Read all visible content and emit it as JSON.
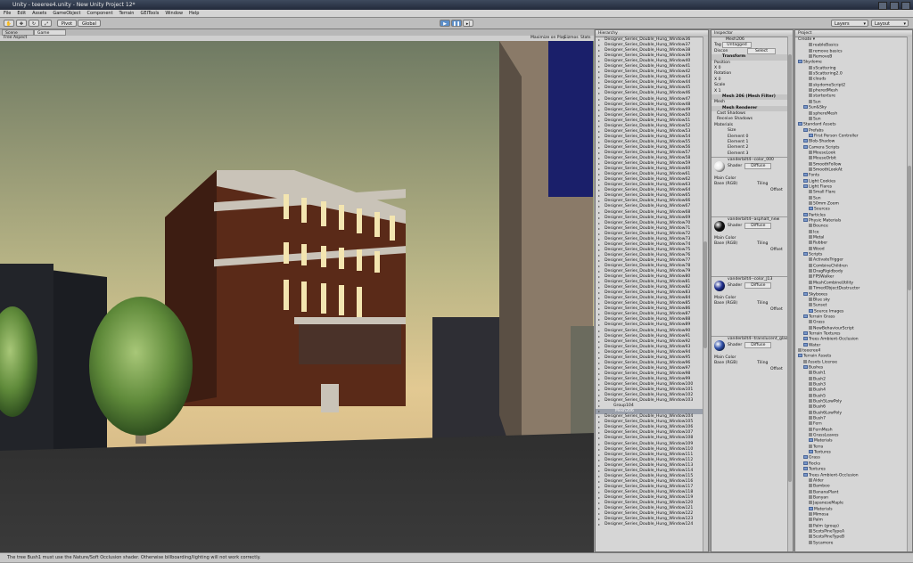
{
  "window": {
    "title": "Unity - teeeree4.unity - New Unity Project 12*"
  },
  "menu": [
    "File",
    "Edit",
    "Assets",
    "GameObject",
    "Component",
    "Terrain",
    "GEITools",
    "Window",
    "Help"
  ],
  "toolbar": {
    "pivot": "Pivot",
    "global": "Global",
    "layers": "Layers",
    "layout": "Layout"
  },
  "game": {
    "tabs": [
      "Scene",
      "Game"
    ],
    "aspect": "Free Aspect",
    "buttons": [
      "Maximize on Play",
      "Gizmos",
      "Stats"
    ]
  },
  "hierarchy": {
    "title": "Hierarchy",
    "group_label": "Group104",
    "selected_label": "Mesh206",
    "rows_a": [
      "Designer_Series_Double_Hung_Window36",
      "Designer_Series_Double_Hung_Window37",
      "Designer_Series_Double_Hung_Window38",
      "Designer_Series_Double_Hung_Window39",
      "Designer_Series_Double_Hung_Window40",
      "Designer_Series_Double_Hung_Window41",
      "Designer_Series_Double_Hung_Window42",
      "Designer_Series_Double_Hung_Window43",
      "Designer_Series_Double_Hung_Window44",
      "Designer_Series_Double_Hung_Window45",
      "Designer_Series_Double_Hung_Window46",
      "Designer_Series_Double_Hung_Window47",
      "Designer_Series_Double_Hung_Window48",
      "Designer_Series_Double_Hung_Window49",
      "Designer_Series_Double_Hung_Window50",
      "Designer_Series_Double_Hung_Window51",
      "Designer_Series_Double_Hung_Window52",
      "Designer_Series_Double_Hung_Window53",
      "Designer_Series_Double_Hung_Window54",
      "Designer_Series_Double_Hung_Window55",
      "Designer_Series_Double_Hung_Window56",
      "Designer_Series_Double_Hung_Window57",
      "Designer_Series_Double_Hung_Window58",
      "Designer_Series_Double_Hung_Window59",
      "Designer_Series_Double_Hung_Window60",
      "Designer_Series_Double_Hung_Window61",
      "Designer_Series_Double_Hung_Window62",
      "Designer_Series_Double_Hung_Window63",
      "Designer_Series_Double_Hung_Window64",
      "Designer_Series_Double_Hung_Window65",
      "Designer_Series_Double_Hung_Window66",
      "Designer_Series_Double_Hung_Window67",
      "Designer_Series_Double_Hung_Window68",
      "Designer_Series_Double_Hung_Window69",
      "Designer_Series_Double_Hung_Window70",
      "Designer_Series_Double_Hung_Window71",
      "Designer_Series_Double_Hung_Window72",
      "Designer_Series_Double_Hung_Window73",
      "Designer_Series_Double_Hung_Window74",
      "Designer_Series_Double_Hung_Window75",
      "Designer_Series_Double_Hung_Window76",
      "Designer_Series_Double_Hung_Window77",
      "Designer_Series_Double_Hung_Window78",
      "Designer_Series_Double_Hung_Window79",
      "Designer_Series_Double_Hung_Window80",
      "Designer_Series_Double_Hung_Window81",
      "Designer_Series_Double_Hung_Window82",
      "Designer_Series_Double_Hung_Window83",
      "Designer_Series_Double_Hung_Window84",
      "Designer_Series_Double_Hung_Window85",
      "Designer_Series_Double_Hung_Window86",
      "Designer_Series_Double_Hung_Window87",
      "Designer_Series_Double_Hung_Window88",
      "Designer_Series_Double_Hung_Window89",
      "Designer_Series_Double_Hung_Window90",
      "Designer_Series_Double_Hung_Window91",
      "Designer_Series_Double_Hung_Window92",
      "Designer_Series_Double_Hung_Window93",
      "Designer_Series_Double_Hung_Window94",
      "Designer_Series_Double_Hung_Window95",
      "Designer_Series_Double_Hung_Window96",
      "Designer_Series_Double_Hung_Window97",
      "Designer_Series_Double_Hung_Window98",
      "Designer_Series_Double_Hung_Window99",
      "Designer_Series_Double_Hung_Window100",
      "Designer_Series_Double_Hung_Window101",
      "Designer_Series_Double_Hung_Window102",
      "Designer_Series_Double_Hung_Window103"
    ],
    "rows_b": [
      "Designer_Series_Double_Hung_Window104",
      "Designer_Series_Double_Hung_Window105",
      "Designer_Series_Double_Hung_Window106",
      "Designer_Series_Double_Hung_Window107",
      "Designer_Series_Double_Hung_Window108",
      "Designer_Series_Double_Hung_Window109",
      "Designer_Series_Double_Hung_Window110",
      "Designer_Series_Double_Hung_Window111",
      "Designer_Series_Double_Hung_Window112",
      "Designer_Series_Double_Hung_Window113",
      "Designer_Series_Double_Hung_Window114",
      "Designer_Series_Double_Hung_Window115",
      "Designer_Series_Double_Hung_Window116",
      "Designer_Series_Double_Hung_Window117",
      "Designer_Series_Double_Hung_Window118",
      "Designer_Series_Double_Hung_Window119",
      "Designer_Series_Double_Hung_Window120",
      "Designer_Series_Double_Hung_Window121",
      "Designer_Series_Double_Hung_Window122",
      "Designer_Series_Double_Hung_Window123",
      "Designer_Series_Double_Hung_Window124"
    ]
  },
  "inspector": {
    "title": "Inspector",
    "object_name": "Mesh206",
    "tag_label": "Tag",
    "tag_value": "Untagged",
    "discon_label": "Discon",
    "select_btn": "Select",
    "transform": "Transform",
    "position": "Position",
    "rotation": "Rotation",
    "scale": "Scale",
    "xyz": [
      "X",
      "Y",
      "Z"
    ],
    "position_values": [
      "0",
      "0",
      "0"
    ],
    "rotation_values": [
      "0",
      "0",
      "0"
    ],
    "scale_values": [
      "1",
      "1",
      "1"
    ],
    "mesh_filter": "Mesh 206 (Mesh Filter)",
    "mesh_label": "Mesh",
    "mesh_renderer": "Mesh Renderer",
    "cast_shadows": "Cast Shadows",
    "receive_shadows": "Receive Shadows",
    "materials": "Materials",
    "size": "Size",
    "elements": [
      "Element 0",
      "Element 1",
      "Element 2",
      "Element 3"
    ],
    "shader_label": "Shader",
    "shader_value": "Diffuse",
    "main_color": "Main Color",
    "base_rgb": "Base (RGB)",
    "tiling": "Tiling",
    "offset": "Offset",
    "mats": [
      {
        "name": "vanderbilt4--color_000",
        "color": "#e8e8e8"
      },
      {
        "name": "vanderbilt4--asphalt_new",
        "color": "#111111"
      },
      {
        "name": "vanderbilt4--color_J13",
        "color": "#1f2f8f"
      },
      {
        "name": "vanderbilt4--translucent_glass_1",
        "color": "#2f4fa8"
      }
    ]
  },
  "project": {
    "title": "Project",
    "create": "Create",
    "items": [
      {
        "t": "reableBasics",
        "i": 2,
        "k": "f"
      },
      {
        "t": "remove basics",
        "i": 2,
        "k": "f"
      },
      {
        "t": "RemoveB",
        "i": 2,
        "k": "f"
      },
      {
        "t": "Skydome",
        "i": 0,
        "k": "d"
      },
      {
        "t": "sScattering",
        "i": 2,
        "k": "f"
      },
      {
        "t": "sScattering2.0",
        "i": 2,
        "k": "f"
      },
      {
        "t": "clouds",
        "i": 2,
        "k": "f"
      },
      {
        "t": "skydomeScript2",
        "i": 2,
        "k": "f"
      },
      {
        "t": "pheredMesh",
        "i": 2,
        "k": "f"
      },
      {
        "t": "startexture",
        "i": 2,
        "k": "f"
      },
      {
        "t": "Sun",
        "i": 2,
        "k": "f"
      },
      {
        "t": "Sun&Sky",
        "i": 1,
        "k": "d"
      },
      {
        "t": "sphereMesh",
        "i": 2,
        "k": "f"
      },
      {
        "t": "Sun",
        "i": 2,
        "k": "f"
      },
      {
        "t": "Standard Assets",
        "i": 0,
        "k": "d"
      },
      {
        "t": "Prefabs",
        "i": 1,
        "k": "d"
      },
      {
        "t": "First Person Controller",
        "i": 2,
        "k": "d"
      },
      {
        "t": "Blob-Shadow",
        "i": 1,
        "k": "d"
      },
      {
        "t": "Camera Scripts",
        "i": 1,
        "k": "d"
      },
      {
        "t": "MouseLook",
        "i": 2,
        "k": "f"
      },
      {
        "t": "MouseOrbit",
        "i": 2,
        "k": "f"
      },
      {
        "t": "SmoothFollow",
        "i": 2,
        "k": "f"
      },
      {
        "t": "SmoothLookAt",
        "i": 2,
        "k": "f"
      },
      {
        "t": "Fonts",
        "i": 1,
        "k": "d"
      },
      {
        "t": "Light Cookies",
        "i": 1,
        "k": "d"
      },
      {
        "t": "Light Flares",
        "i": 1,
        "k": "d"
      },
      {
        "t": "Small Flare",
        "i": 2,
        "k": "f"
      },
      {
        "t": "Sun",
        "i": 2,
        "k": "f"
      },
      {
        "t": "50mm Zoom",
        "i": 2,
        "k": "f"
      },
      {
        "t": "Sources",
        "i": 2,
        "k": "d"
      },
      {
        "t": "Particles",
        "i": 1,
        "k": "d"
      },
      {
        "t": "Physic Materials",
        "i": 1,
        "k": "d"
      },
      {
        "t": "Bounce",
        "i": 2,
        "k": "f"
      },
      {
        "t": "Ice",
        "i": 2,
        "k": "f"
      },
      {
        "t": "Metal",
        "i": 2,
        "k": "f"
      },
      {
        "t": "Rubber",
        "i": 2,
        "k": "f"
      },
      {
        "t": "Wood",
        "i": 2,
        "k": "f"
      },
      {
        "t": "Scripts",
        "i": 1,
        "k": "d"
      },
      {
        "t": "ActivateTrigger",
        "i": 2,
        "k": "f"
      },
      {
        "t": "CombineChildren",
        "i": 2,
        "k": "f"
      },
      {
        "t": "DragRigidbody",
        "i": 2,
        "k": "f"
      },
      {
        "t": "FPSWalker",
        "i": 2,
        "k": "f"
      },
      {
        "t": "MeshCombineUtility",
        "i": 2,
        "k": "f"
      },
      {
        "t": "TimedObjectDestructor",
        "i": 2,
        "k": "f"
      },
      {
        "t": "Skyboxes",
        "i": 1,
        "k": "d"
      },
      {
        "t": "Blue sky",
        "i": 2,
        "k": "f"
      },
      {
        "t": "Sunset",
        "i": 2,
        "k": "f"
      },
      {
        "t": "Source Images",
        "i": 2,
        "k": "d"
      },
      {
        "t": "Terrain Grass",
        "i": 1,
        "k": "d"
      },
      {
        "t": "Grass",
        "i": 2,
        "k": "f"
      },
      {
        "t": "NewBehaviourScript",
        "i": 2,
        "k": "f"
      },
      {
        "t": "Terrain Textures",
        "i": 1,
        "k": "d"
      },
      {
        "t": "Trees Ambient-Occlusion",
        "i": 1,
        "k": "d"
      },
      {
        "t": "Water",
        "i": 1,
        "k": "d"
      },
      {
        "t": "teeeree4",
        "i": 0,
        "k": "f"
      },
      {
        "t": "Terrain Assets",
        "i": 0,
        "k": "d"
      },
      {
        "t": "Assets License",
        "i": 1,
        "k": "f"
      },
      {
        "t": "Bushes",
        "i": 1,
        "k": "d"
      },
      {
        "t": "Bush1",
        "i": 2,
        "k": "f"
      },
      {
        "t": "Bush2",
        "i": 2,
        "k": "f"
      },
      {
        "t": "Bush3",
        "i": 2,
        "k": "f"
      },
      {
        "t": "Bush4",
        "i": 2,
        "k": "f"
      },
      {
        "t": "Bush5",
        "i": 2,
        "k": "f"
      },
      {
        "t": "Bush5LowPoly",
        "i": 2,
        "k": "f"
      },
      {
        "t": "Bush6",
        "i": 2,
        "k": "f"
      },
      {
        "t": "Bush6LowPoly",
        "i": 2,
        "k": "f"
      },
      {
        "t": "Bush7",
        "i": 2,
        "k": "f"
      },
      {
        "t": "Fern",
        "i": 2,
        "k": "f"
      },
      {
        "t": "FernMesh",
        "i": 2,
        "k": "f"
      },
      {
        "t": "GrassLeaves",
        "i": 2,
        "k": "f"
      },
      {
        "t": "Materials",
        "i": 2,
        "k": "d"
      },
      {
        "t": "Terra",
        "i": 2,
        "k": "f"
      },
      {
        "t": "Textures",
        "i": 2,
        "k": "d"
      },
      {
        "t": "Grass",
        "i": 1,
        "k": "d"
      },
      {
        "t": "Rocks",
        "i": 1,
        "k": "d"
      },
      {
        "t": "Textures",
        "i": 1,
        "k": "d"
      },
      {
        "t": "Trees Ambient-Occlusion",
        "i": 1,
        "k": "d"
      },
      {
        "t": "Alder",
        "i": 2,
        "k": "f"
      },
      {
        "t": "Bamboo",
        "i": 2,
        "k": "f"
      },
      {
        "t": "BananaPlant",
        "i": 2,
        "k": "f"
      },
      {
        "t": "Banyan",
        "i": 2,
        "k": "f"
      },
      {
        "t": "JapaneseMaple",
        "i": 2,
        "k": "f"
      },
      {
        "t": "Materials",
        "i": 2,
        "k": "d"
      },
      {
        "t": "Mimosa",
        "i": 2,
        "k": "f"
      },
      {
        "t": "Palm",
        "i": 2,
        "k": "f"
      },
      {
        "t": "Palm (group)",
        "i": 2,
        "k": "f"
      },
      {
        "t": "ScotsPineTypeA",
        "i": 2,
        "k": "f"
      },
      {
        "t": "ScotsPineTypeB",
        "i": 2,
        "k": "f"
      },
      {
        "t": "Sycamore",
        "i": 2,
        "k": "f"
      }
    ]
  },
  "status": {
    "message": "The tree Bush1 must use the Nature/Soft Occlusion shader. Otherwise billboarding/lighting will not work correctly."
  }
}
